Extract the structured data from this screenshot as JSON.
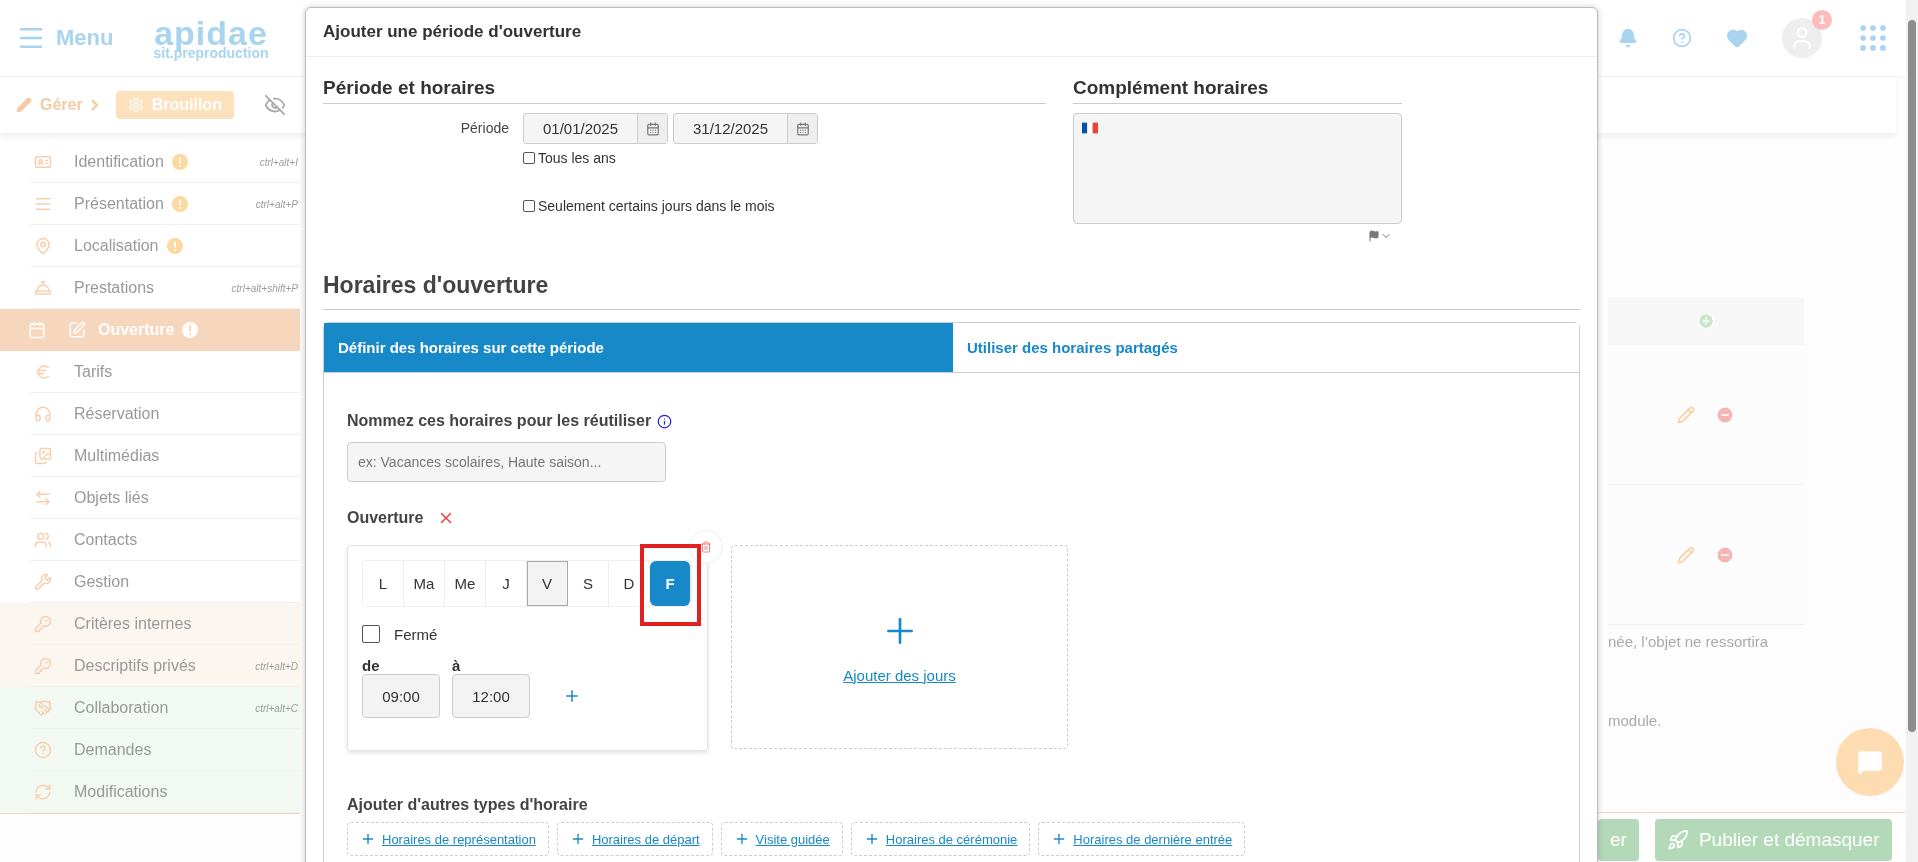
{
  "app_header": {
    "menu_label": "Menu",
    "logo": "apidae",
    "logo_subtitle": "sit.preproduction",
    "notification_count": "1"
  },
  "toolbar": {
    "breadcrumb": "Gérer",
    "status": "Brouillon"
  },
  "sidebar": {
    "items": [
      {
        "label": "Identification",
        "shortcut": "ctrl+alt+I",
        "warning": true,
        "selected": false,
        "kind": "standard"
      },
      {
        "label": "Présentation",
        "shortcut": "ctrl+alt+P",
        "warning": true,
        "selected": false,
        "kind": "standard"
      },
      {
        "label": "Localisation",
        "warning": true,
        "selected": false,
        "kind": "standard"
      },
      {
        "label": "Prestations",
        "shortcut": "ctrl+alt+shift+P",
        "warning": false,
        "selected": false,
        "kind": "standard"
      },
      {
        "label": "Ouverture",
        "warning": true,
        "selected": true,
        "kind": "standard"
      },
      {
        "label": "Tarifs",
        "warning": false,
        "selected": false,
        "kind": "standard"
      },
      {
        "label": "Réservation",
        "warning": false,
        "selected": false,
        "kind": "standard"
      },
      {
        "label": "Multimédias",
        "warning": false,
        "selected": false,
        "kind": "standard"
      },
      {
        "label": "Objets liés",
        "warning": false,
        "selected": false,
        "kind": "standard"
      },
      {
        "label": "Contacts",
        "warning": false,
        "selected": false,
        "kind": "standard"
      },
      {
        "label": "Gestion",
        "warning": false,
        "selected": false,
        "kind": "standard"
      },
      {
        "label": "Critères internes",
        "warning": false,
        "selected": false,
        "kind": "private"
      },
      {
        "label": "Descriptifs privés",
        "shortcut": "ctrl+alt+D",
        "warning": false,
        "selected": false,
        "kind": "private"
      },
      {
        "label": "Collaboration",
        "shortcut": "ctrl+alt+C",
        "warning": false,
        "selected": false,
        "kind": "shared"
      },
      {
        "label": "Demandes",
        "warning": false,
        "selected": false,
        "kind": "shared"
      },
      {
        "label": "Modifications",
        "warning": false,
        "selected": false,
        "kind": "shared"
      }
    ]
  },
  "background": {
    "notes": [
      "née, l’objet ne ressortira",
      "module."
    ],
    "buttons": [
      "er",
      "Publier et démasquer"
    ]
  },
  "modal": {
    "title": "Ajouter une période d'ouverture",
    "period": {
      "title": "Période et horaires",
      "label": "Période",
      "start_date": "01/01/2025",
      "end_date": "31/12/2025",
      "checkboxes": [
        {
          "label": "Tous les ans",
          "checked": false
        },
        {
          "label": "Seulement certains jours dans le mois",
          "checked": false
        }
      ]
    },
    "complement": {
      "title": "Complément horaires"
    },
    "hours_title": "Horaires d'ouverture",
    "tabs": [
      {
        "label": "Définir des horaires sur cette période",
        "selected": true
      },
      {
        "label": "Utiliser des horaires partagés",
        "selected": false
      }
    ],
    "name_label": "Nommez ces horaires pour les réutiliser",
    "name_placeholder": "ex: Vacances scolaires, Haute saison...",
    "opening": {
      "label": "Ouverture",
      "days": [
        {
          "label": "L",
          "selected": false,
          "pressed": false,
          "highlighted": false
        },
        {
          "label": "Ma",
          "selected": false,
          "pressed": false,
          "highlighted": false
        },
        {
          "label": "Me",
          "selected": false,
          "pressed": false,
          "highlighted": false
        },
        {
          "label": "J",
          "selected": false,
          "pressed": false,
          "highlighted": false
        },
        {
          "label": "V",
          "selected": false,
          "pressed": true,
          "highlighted": false
        },
        {
          "label": "S",
          "selected": false,
          "pressed": false,
          "highlighted": false
        },
        {
          "label": "D",
          "selected": false,
          "pressed": false,
          "highlighted": false
        },
        {
          "label": "F",
          "selected": true,
          "pressed": false,
          "highlighted": true
        }
      ],
      "closed": {
        "label": "Fermé",
        "checked": false
      },
      "from_label": "de",
      "to_label": "à",
      "from": "09:00",
      "to": "12:00"
    },
    "add_days": "Ajouter des jours",
    "other_types_title": "Ajouter d'autres types d'horaire",
    "other_types": [
      "Horaires de représentation",
      "Horaires de départ",
      "Visite guidée",
      "Horaires de cérémonie",
      "Horaires de dernière entrée"
    ]
  }
}
